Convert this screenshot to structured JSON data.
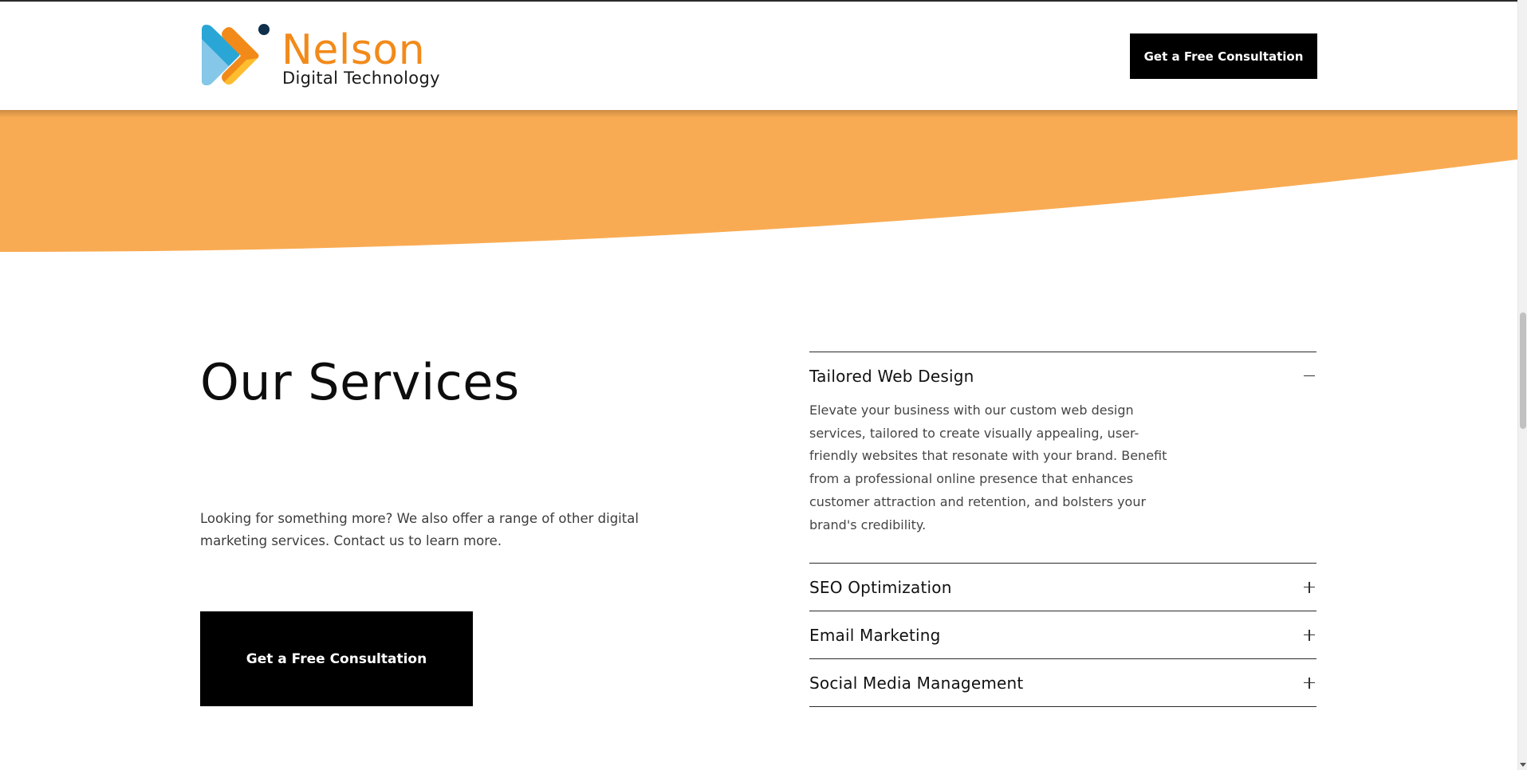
{
  "brand": {
    "name": "Nelson",
    "tagline": "Digital Technology",
    "primary_color": "#f28a1a",
    "band_color": "#f9ab53"
  },
  "header": {
    "cta_label": "Get a Free Consultation"
  },
  "services": {
    "title": "Our Services",
    "intro": "Looking for something more? We also offer a range of other digital marketing services. Contact us to learn more.",
    "cta_label": "Get a Free Consultation",
    "accordion": [
      {
        "title": "Tailored Web Design",
        "expanded": true,
        "toggle_icon": "minus-icon",
        "body": "Elevate your business with our custom web design services, tailored to create visually appealing, user-friendly websites that resonate with your brand. Benefit from a professional online presence that enhances customer attraction and retention, and bolsters your brand's credibility."
      },
      {
        "title": "SEO Optimization",
        "expanded": false,
        "toggle_icon": "plus-icon"
      },
      {
        "title": "Email Marketing",
        "expanded": false,
        "toggle_icon": "plus-icon"
      },
      {
        "title": "Social Media Management",
        "expanded": false,
        "toggle_icon": "plus-icon"
      }
    ]
  }
}
